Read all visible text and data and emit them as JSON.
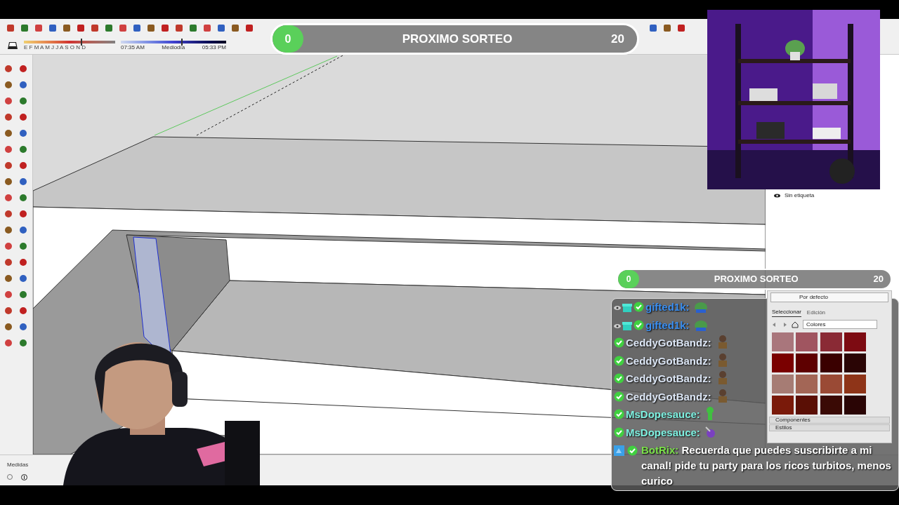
{
  "toolbar": {
    "months": "E F M A M J J A S O N D",
    "month_slider": {
      "level": 0.62
    },
    "time_start": "07:35 AM",
    "time_mid": "Mediodía",
    "time_end": "05:33 PM",
    "time_slider": {
      "level": 0.57
    }
  },
  "top_giveaway_bar": {
    "count": "0",
    "label": "PROXIMO SORTEO",
    "goal": "20",
    "level": 0
  },
  "chat_giveaway_bar": {
    "count": "0",
    "label": "PROXIMO SORTEO",
    "goal": "20",
    "level": 0
  },
  "tags_panel": {
    "items": [
      {
        "label": "Sin etiqueta"
      }
    ]
  },
  "materials_panel": {
    "default_label": "Por defecto",
    "tabs": [
      {
        "label": "Seleccionar",
        "selected": true
      },
      {
        "label": "Edición",
        "selected": false
      }
    ],
    "library": "Colores",
    "swatches": [
      {
        "color": "#a9767c"
      },
      {
        "color": "#a05560"
      },
      {
        "color": "#8a2a35"
      },
      {
        "color": "#7d0b12"
      },
      {
        "color": "#7a0000"
      },
      {
        "color": "#5e0000"
      },
      {
        "color": "#3a0000"
      },
      {
        "color": "#2a0505"
      },
      {
        "color": "#a67c74"
      },
      {
        "color": "#a36656"
      },
      {
        "color": "#9a4a35"
      },
      {
        "color": "#8e3418"
      },
      {
        "color": "#7a1a0a"
      },
      {
        "color": "#5a0f05"
      },
      {
        "color": "#3a0a05"
      },
      {
        "color": "#2a0505"
      }
    ],
    "sections": [
      "Componentes",
      "Estilos"
    ]
  },
  "chat": {
    "messages": [
      {
        "kind": "frog",
        "watching": true,
        "gift_badge": true,
        "verified": true,
        "user": "gifted1k:",
        "color": "#3a8ef0"
      },
      {
        "kind": "frog",
        "watching": true,
        "gift_badge": true,
        "verified": true,
        "user": "gifted1k:",
        "color": "#3a8ef0"
      },
      {
        "kind": "figure",
        "watching": false,
        "gift_badge": false,
        "verified": true,
        "user": "CeddyGotBandz:",
        "color": "#dce6f5"
      },
      {
        "kind": "figure",
        "watching": false,
        "gift_badge": false,
        "verified": true,
        "user": "CeddyGotBandz:",
        "color": "#dce6f5"
      },
      {
        "kind": "figure",
        "watching": false,
        "gift_badge": false,
        "verified": true,
        "user": "CeddyGotBandz:",
        "color": "#dce6f5"
      },
      {
        "kind": "figure",
        "watching": false,
        "gift_badge": false,
        "verified": true,
        "user": "CeddyGotBandz:",
        "color": "#dce6f5"
      },
      {
        "kind": "alien",
        "watching": false,
        "gift_badge": false,
        "verified": true,
        "user": "MsDopesauce:",
        "color": "#7ef0e0"
      },
      {
        "kind": "cat",
        "watching": false,
        "gift_badge": false,
        "verified": true,
        "user": "MsDopesauce:",
        "color": "#7ef0e0"
      },
      {
        "kind": "bot",
        "watching": false,
        "gift_badge": false,
        "verified": true,
        "user": "BotRix:",
        "color": "#7be04a",
        "text": "Recuerda que puedes suscribirte a mi canal! pide tu party para los ricos turbitos, menos curico"
      }
    ]
  },
  "status_bar": {
    "label": "Medidas"
  }
}
